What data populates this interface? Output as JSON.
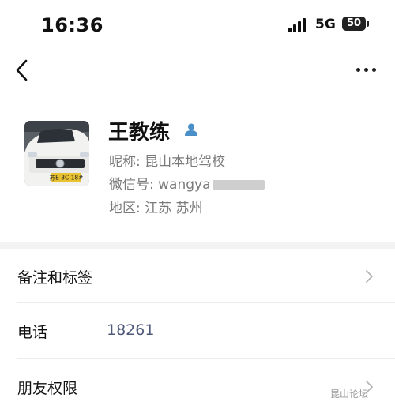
{
  "status_bar": {
    "time": "16:36",
    "network": "5G",
    "battery": "50"
  },
  "nav": {
    "back_icon": "chevron-left-icon",
    "more_icon": "more-dots-icon"
  },
  "profile": {
    "name": "王教练",
    "nickname_label": "昵称:",
    "nickname": "昆山本地驾校",
    "wechat_label": "微信号:",
    "wechat_id_visible": "wangya",
    "region_label": "地区:",
    "region": "江苏 苏州",
    "avatar_plate": "苏E 3C 18#",
    "verified_icon": "user-verified-icon"
  },
  "rows": [
    {
      "label": "备注和标签",
      "value": "",
      "chevron": true
    },
    {
      "label": "电话",
      "value": "18261",
      "chevron": false
    },
    {
      "label": "朋友权限",
      "value": "",
      "chevron": true
    }
  ],
  "watermark": "昆山论坛",
  "colors": {
    "text": "#111111",
    "secondary_text": "#7a7a7a",
    "phone_link": "#4f5a7a",
    "verified_badge": "#4a8fc7"
  }
}
